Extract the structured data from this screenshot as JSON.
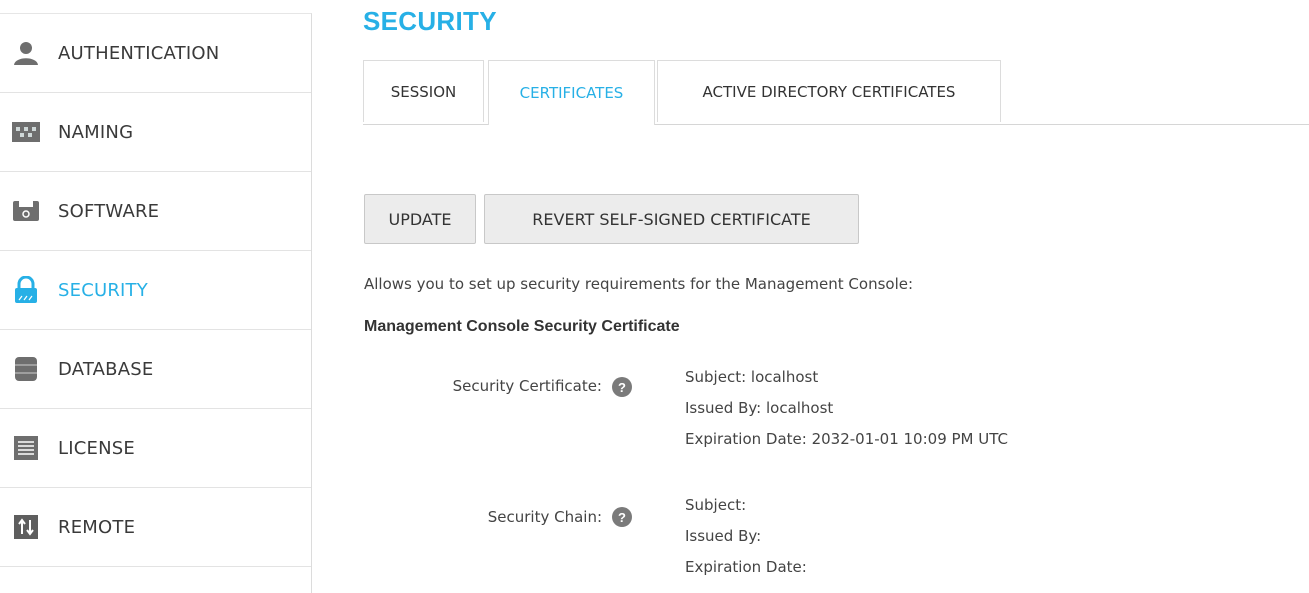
{
  "page_title": "SECURITY",
  "sidebar": {
    "items": [
      {
        "label": "AUTHENTICATION",
        "icon": "user-icon"
      },
      {
        "label": "NAMING",
        "icon": "naming-icon"
      },
      {
        "label": "SOFTWARE",
        "icon": "software-icon"
      },
      {
        "label": "SECURITY",
        "icon": "lock-icon",
        "active": true
      },
      {
        "label": "DATABASE",
        "icon": "database-icon"
      },
      {
        "label": "LICENSE",
        "icon": "license-icon"
      },
      {
        "label": "REMOTE",
        "icon": "remote-icon"
      }
    ]
  },
  "tabs": [
    {
      "label": "SESSION"
    },
    {
      "label": "CERTIFICATES",
      "active": true
    },
    {
      "label": "ACTIVE DIRECTORY CERTIFICATES"
    }
  ],
  "buttons": {
    "update": "UPDATE",
    "revert": "REVERT SELF-SIGNED CERTIFICATE"
  },
  "description": "Allows you to set up security requirements for the Management Console:",
  "section_heading": "Management Console Security Certificate",
  "security_certificate": {
    "label": "Security Certificate:",
    "subject": "Subject: localhost",
    "issued_by": "Issued By: localhost",
    "expiration": "Expiration Date: 2032-01-01 10:09 PM UTC"
  },
  "security_chain": {
    "label": "Security Chain:",
    "subject": "Subject:",
    "issued_by": "Issued By:",
    "expiration": "Expiration Date:"
  },
  "help_glyph": "?",
  "colors": {
    "accent": "#27b0e6",
    "icon_gray": "#7a7a7a"
  }
}
